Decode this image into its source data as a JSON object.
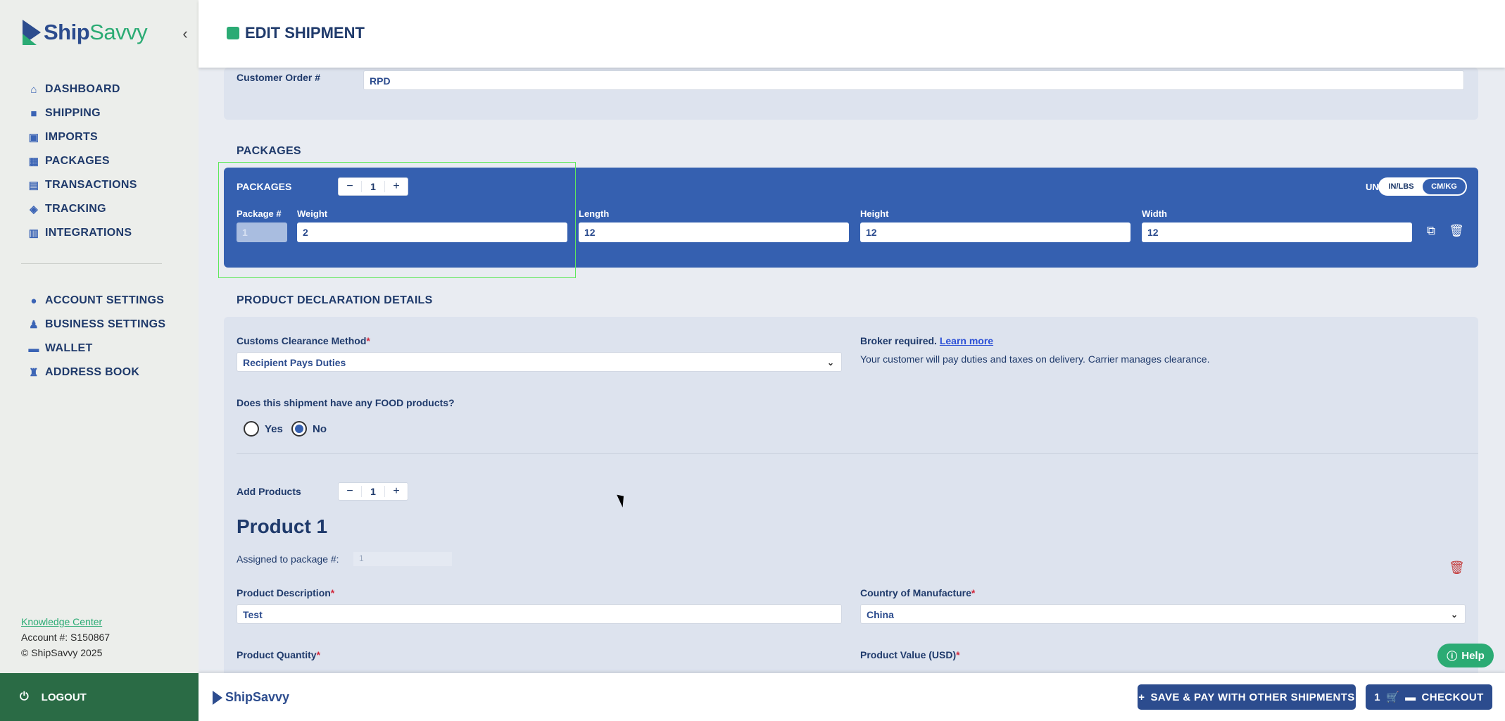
{
  "app": {
    "brand_ship": "Ship",
    "brand_savvy": "Savvy",
    "footer_brand": "ShipSavvy"
  },
  "header": {
    "title": "EDIT SHIPMENT"
  },
  "sidebar": {
    "items": [
      {
        "label": "DASHBOARD",
        "icon": "home-icon"
      },
      {
        "label": "SHIPPING",
        "icon": "shipping-icon"
      },
      {
        "label": "IMPORTS",
        "icon": "imports-icon"
      },
      {
        "label": "PACKAGES",
        "icon": "packages-icon"
      },
      {
        "label": "TRANSACTIONS",
        "icon": "transactions-icon"
      },
      {
        "label": "TRACKING",
        "icon": "tracking-icon"
      },
      {
        "label": "INTEGRATIONS",
        "icon": "integrations-icon"
      }
    ],
    "settings_items": [
      {
        "label": "ACCOUNT SETTINGS",
        "icon": "account-icon"
      },
      {
        "label": "BUSINESS SETTINGS",
        "icon": "business-icon"
      },
      {
        "label": "WALLET",
        "icon": "wallet-icon"
      },
      {
        "label": "ADDRESS BOOK",
        "icon": "address-book-icon"
      }
    ],
    "knowledge_center": "Knowledge Center",
    "account": "Account #: S150867",
    "copyright": "© ShipSavvy 2025",
    "logout": "LOGOUT"
  },
  "order": {
    "label": "Customer Order #",
    "value": "RPD"
  },
  "packages": {
    "section_title": "PACKAGES",
    "label": "PACKAGES",
    "count": "1",
    "units_label": "UNITS",
    "units_options": [
      "IN/LBS",
      "CM/KG"
    ],
    "units_selected": "CM/KG",
    "columns": {
      "package": "Package #",
      "weight": "Weight",
      "length": "Length",
      "height": "Height",
      "width": "Width"
    },
    "row": {
      "package": "1",
      "weight": "2",
      "length": "12",
      "height": "12",
      "width": "12"
    }
  },
  "declaration": {
    "section_title": "PRODUCT DECLARATION DETAILS",
    "clearance_label": "Customs Clearance Method",
    "clearance_value": "Recipient Pays Duties",
    "broker_text": "Broker required.",
    "learn_more": "Learn more",
    "broker_note": "Your customer will pay duties and taxes on delivery. Carrier manages clearance.",
    "food_question": "Does this shipment have any FOOD products?",
    "food_yes": "Yes",
    "food_no": "No",
    "food_selected": "No",
    "add_products_label": "Add Products",
    "products_count": "1",
    "product_title": "Product 1",
    "assigned_label": "Assigned to package #:",
    "assigned_value": "1",
    "description_label": "Product Description",
    "description_value": "Test",
    "country_label": "Country of Manufacture",
    "country_value": "China",
    "quantity_label": "Product Quantity",
    "value_label": "Product Value (USD)"
  },
  "help": "Help",
  "footer": {
    "save_pay": "SAVE & PAY WITH OTHER SHIPMENTS",
    "cart_count": "1",
    "checkout": "CHECKOUT"
  }
}
